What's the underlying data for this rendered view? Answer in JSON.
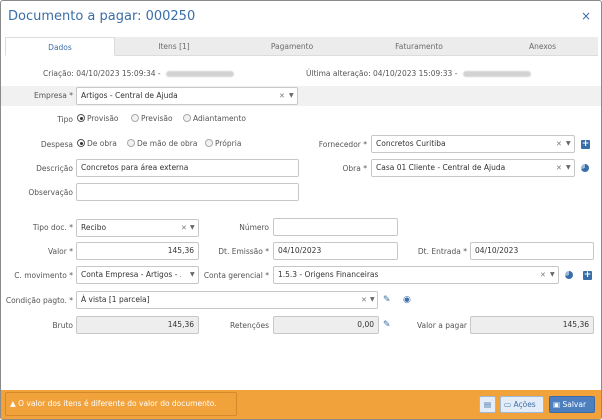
{
  "dialog": {
    "title": "Documento a pagar: 000250",
    "close_glyph": "×"
  },
  "tabs": [
    {
      "label": "Dados"
    },
    {
      "label": "Itens [1]"
    },
    {
      "label": "Pagamento"
    },
    {
      "label": "Faturamento"
    },
    {
      "label": "Anexos"
    }
  ],
  "meta": {
    "criacao_label": "Criação:",
    "criacao_value": "04/10/2023 15:09:34 -",
    "alteracao_label": "Última alteração:",
    "alteracao_value": "04/10/2023 15:09:33 -"
  },
  "form": {
    "empresa": {
      "label": "Empresa *",
      "value": "Artigos - Central de Ajuda"
    },
    "tipo": {
      "label": "Tipo",
      "options": [
        "Provisão",
        "Previsão",
        "Adiantamento"
      ],
      "selected": 0
    },
    "despesa": {
      "label": "Despesa",
      "options": [
        "De obra",
        "De mão de obra",
        "Própria"
      ],
      "selected": 0
    },
    "fornecedor": {
      "label": "Fornecedor *",
      "value": "Concretos Curitiba"
    },
    "descricao": {
      "label": "Descrição",
      "value": "Concretos para área externa"
    },
    "obra": {
      "label": "Obra *",
      "value": "Casa 01 Cliente - Central de Ajuda"
    },
    "observacao": {
      "label": "Observação",
      "value": ""
    },
    "tipo_doc": {
      "label": "Tipo doc. *",
      "value": "Recibo"
    },
    "numero": {
      "label": "Número",
      "value": ""
    },
    "valor": {
      "label": "Valor *",
      "value": "145,36"
    },
    "dt_emissao": {
      "label": "Dt. Emissão *",
      "value": "04/10/2023"
    },
    "dt_entrada": {
      "label": "Dt. Entrada *",
      "value": "04/10/2023"
    },
    "c_movimento": {
      "label": "C. movimento *",
      "value": "Conta Empresa - Artigos - ..."
    },
    "conta_gerencial": {
      "label": "Conta gerencial *",
      "value": "1.5.3 - Origens Financeiras"
    },
    "condicao_pagto": {
      "label": "Condição pagto. *",
      "value": "À vista [1 parcela]"
    },
    "bruto": {
      "label": "Bruto",
      "value": "145,36"
    },
    "retencoes": {
      "label": "Retenções",
      "value": "0,00"
    },
    "valor_a_pagar": {
      "label": "Valor a pagar",
      "value": "145,36"
    }
  },
  "footer": {
    "warning": "O valor dos itens é diferente do valor do documento.",
    "acoes_label": "Ações",
    "salvar_label": "Salvar"
  },
  "colors": {
    "accent": "#3a6ea8",
    "footer_bg": "#f2a23a"
  }
}
